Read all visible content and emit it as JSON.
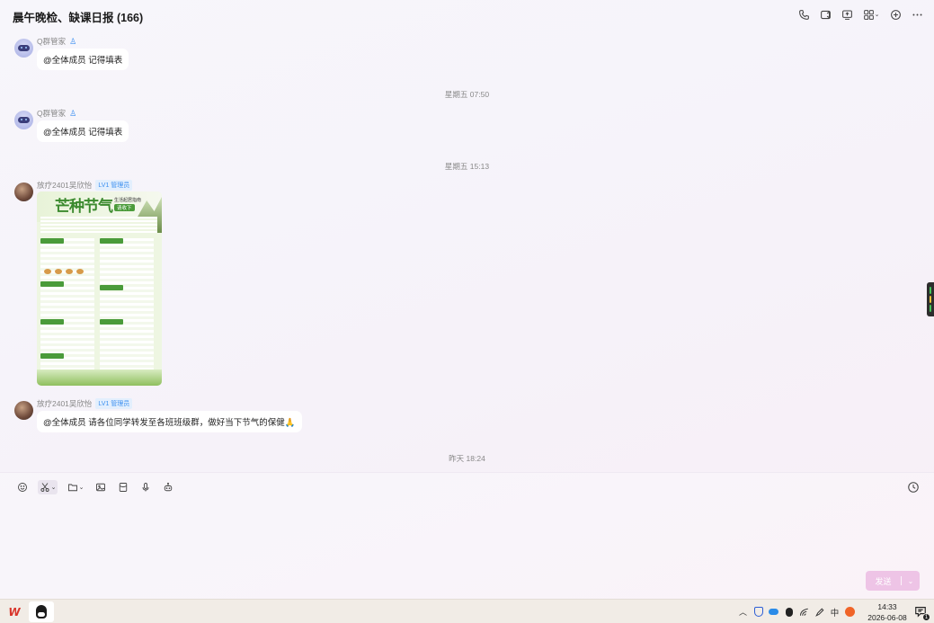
{
  "window": {
    "title": "晨午晚检、缺课日报 (166)"
  },
  "header_actions": [
    {
      "name": "voice-call-icon"
    },
    {
      "name": "video-call-icon"
    },
    {
      "name": "screen-share-icon"
    },
    {
      "name": "apps-icon"
    },
    {
      "name": "add-member-icon"
    },
    {
      "name": "more-icon"
    }
  ],
  "chat": {
    "messages": [
      {
        "type": "text",
        "sender": "Q群管家",
        "robot_icon": "robot-icon",
        "text": "@全体成员 记得填表"
      },
      {
        "type": "timestamp",
        "text": "星期五 07:50"
      },
      {
        "type": "text",
        "sender": "Q群管家",
        "robot_icon": "robot-icon",
        "text": "@全体成员 记得填表"
      },
      {
        "type": "timestamp",
        "text": "星期五 15:13"
      },
      {
        "type": "image",
        "sender": "放疗2401吴欣怡",
        "badge": "LV1 管理员",
        "poster": {
          "title": "芒种节气",
          "subtitle": "生活起居指南",
          "tag": "请收下"
        }
      },
      {
        "type": "text",
        "sender": "放疗2401吴欣怡",
        "badge": "LV1 管理员",
        "text": "@全体成员 请各位同学转发至各班班级群，做好当下节气的保健🙏"
      },
      {
        "type": "timestamp",
        "text": "昨天 18:24"
      }
    ]
  },
  "composer": {
    "send_label": "发送",
    "dropdown_icon": "chevron-down-icon"
  },
  "taskbar": {
    "apps": [
      "WPS",
      "QQ"
    ],
    "time": "14:33",
    "date": "2026-06-08",
    "ime": "中",
    "notification_count": "1"
  }
}
